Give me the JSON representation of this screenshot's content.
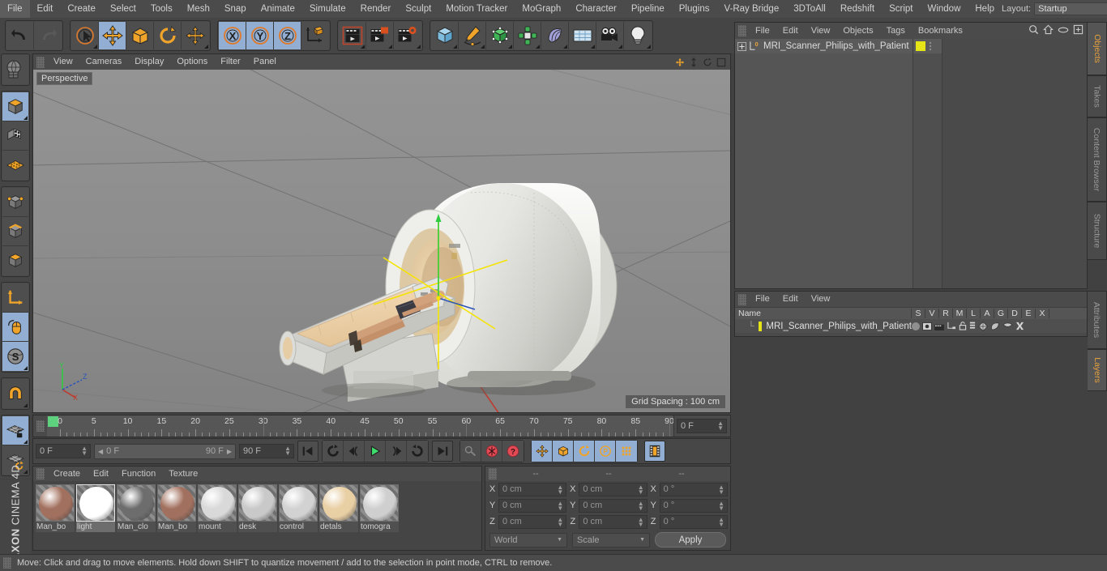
{
  "app": {
    "brand_maxon": "MAXON",
    "brand_c4d": "CINEMA 4D"
  },
  "menubar": {
    "items": [
      "File",
      "Edit",
      "Create",
      "Select",
      "Tools",
      "Mesh",
      "Snap",
      "Animate",
      "Simulate",
      "Render",
      "Sculpt",
      "Motion Tracker",
      "MoGraph",
      "Character",
      "Pipeline",
      "Plugins",
      "V-Ray Bridge",
      "3DToAll",
      "Redshift",
      "Script",
      "Window",
      "Help"
    ],
    "layout_label": "Layout:",
    "layout_value": "Startup"
  },
  "toolbar": {
    "undo": "Undo",
    "redo": "Redo",
    "live_selection": "Live Selection",
    "move": "Move",
    "scale": "Scale",
    "rotate": "Rotate",
    "move_dup": "Move Duplicate",
    "axis_x": "X",
    "axis_y": "Y",
    "axis_z": "Z",
    "world_axis": "World/Object Axis",
    "render_view": "Render View",
    "render_region": "Render Region",
    "render_settings": "Render Settings",
    "cube": "Cube Primitive",
    "pen": "Pen / Spline",
    "nurbs": "NURBS Generator",
    "array": "MoGraph / Array",
    "bend": "Deformer",
    "floor": "Environment/Floor",
    "camera": "Camera",
    "light": "Light"
  },
  "left_toolbar": {
    "items": [
      {
        "name": "make-editable-icon",
        "selected": false
      },
      {
        "name": "model-mode-icon",
        "selected": true
      },
      {
        "name": "texture-mode-icon",
        "selected": false
      },
      {
        "name": "polygon-grid-icon",
        "selected": false
      },
      {
        "name": "points-mode-icon",
        "selected": false
      },
      {
        "name": "edges-mode-icon",
        "selected": false
      },
      {
        "name": "polygons-mode-icon",
        "selected": false
      },
      {
        "name": "world-axis-icon",
        "selected": false
      },
      {
        "name": "viewport-solo-icon",
        "selected": true
      },
      {
        "name": "sds-icon",
        "selected": true
      },
      {
        "name": "magnet-icon",
        "selected": false
      },
      {
        "name": "lock-workplane-icon",
        "selected": true
      },
      {
        "name": "workplane-icon",
        "selected": false
      }
    ]
  },
  "viewport": {
    "menu": [
      "View",
      "Cameras",
      "Display",
      "Options",
      "Filter",
      "Panel"
    ],
    "label": "Perspective",
    "grid_spacing": "Grid Spacing : 100 cm",
    "axis_x": "X",
    "axis_y": "Y",
    "axis_z": "Z"
  },
  "timeline": {
    "ruler_ticks": [
      0,
      5,
      10,
      15,
      20,
      25,
      30,
      35,
      40,
      45,
      50,
      55,
      60,
      65,
      70,
      75,
      80,
      85,
      90
    ],
    "current_frame": "0 F",
    "range_start": "0 F",
    "range_end": "90 F",
    "doc_end": "90 F",
    "preview_min": "0 F",
    "preview_max": "90 F",
    "transport": [
      "go-to-start",
      "frame-back-keyframe",
      "frame-back",
      "play",
      "frame-forward",
      "loop",
      "go-to-end"
    ],
    "record_tools": [
      "autokey",
      "record-active-objects",
      "keyframe-selection"
    ],
    "anim_axes": [
      "position",
      "scale",
      "rotation",
      "pla",
      "point-level"
    ]
  },
  "materials": {
    "menu": [
      "Create",
      "Edit",
      "Function",
      "Texture"
    ],
    "items": [
      {
        "name": "Man_bo",
        "color": "#a2705e",
        "selected": false
      },
      {
        "name": "light",
        "color": "#ffffff",
        "selected": true
      },
      {
        "name": "Man_clo",
        "color": "#6d6d6d",
        "selected": false
      },
      {
        "name": "Man_bo",
        "color": "#a2705e",
        "selected": false
      },
      {
        "name": "mount",
        "color": "#d9d9d9",
        "selected": false
      },
      {
        "name": "desk",
        "color": "#c9c9c9",
        "selected": false
      },
      {
        "name": "control",
        "color": "#d2d2d2",
        "selected": false
      },
      {
        "name": "detals",
        "color": "#e9cfa4",
        "selected": false
      },
      {
        "name": "tomogra",
        "color": "#cfcfcf",
        "selected": false
      }
    ]
  },
  "coordinates": {
    "header": [
      "--",
      "--",
      "--"
    ],
    "rows": [
      {
        "label": "X",
        "position": "0 cm",
        "size": "0 cm",
        "rotation": "0 °"
      },
      {
        "label": "Y",
        "position": "0 cm",
        "size": "0 cm",
        "rotation": "0 °"
      },
      {
        "label": "Z",
        "position": "0 cm",
        "size": "0 cm",
        "rotation": "0 °"
      }
    ],
    "coord_system": "World",
    "size_mode": "Scale",
    "apply": "Apply"
  },
  "object_manager": {
    "menu": [
      "File",
      "Edit",
      "View",
      "Objects",
      "Tags",
      "Bookmarks"
    ],
    "icons": [
      "search-icon",
      "home-icon",
      "eye-icon",
      "expand-icon"
    ],
    "object_name": "MRI_Scanner_Philips_with_Patient",
    "layer_color": "#e4e416"
  },
  "layer_manager": {
    "menu": [
      "File",
      "Edit",
      "View"
    ],
    "columns": [
      "Name",
      "S",
      "V",
      "R",
      "M",
      "L",
      "A",
      "G",
      "D",
      "E",
      "X"
    ],
    "row_name": "MRI_Scanner_Philips_with_Patient",
    "row_color": "#e4e416"
  },
  "right_tabs": [
    {
      "label": "Objects",
      "active": true
    },
    {
      "label": "Takes",
      "active": false
    },
    {
      "label": "Content Browser",
      "active": false
    },
    {
      "label": "Structure",
      "active": false
    },
    {
      "label": "Attributes",
      "active": false
    },
    {
      "label": "Layers",
      "active": true
    }
  ],
  "status": {
    "message": "Move: Click and drag to move elements. Hold down SHIFT to quantize movement / add to the selection in point mode, CTRL to remove."
  },
  "colors": {
    "accent_orange": "#e8a33d",
    "selection_blue": "#92aed2",
    "panel_bg": "#454545",
    "menu_bg": "#4b4b4b",
    "viewport_bg": "#8a8a8a",
    "axis_x_red": "#c0392b",
    "axis_y_green": "#27ae60",
    "axis_z_blue": "#2d55b8",
    "gizmo_yellow": "#f2e500"
  }
}
